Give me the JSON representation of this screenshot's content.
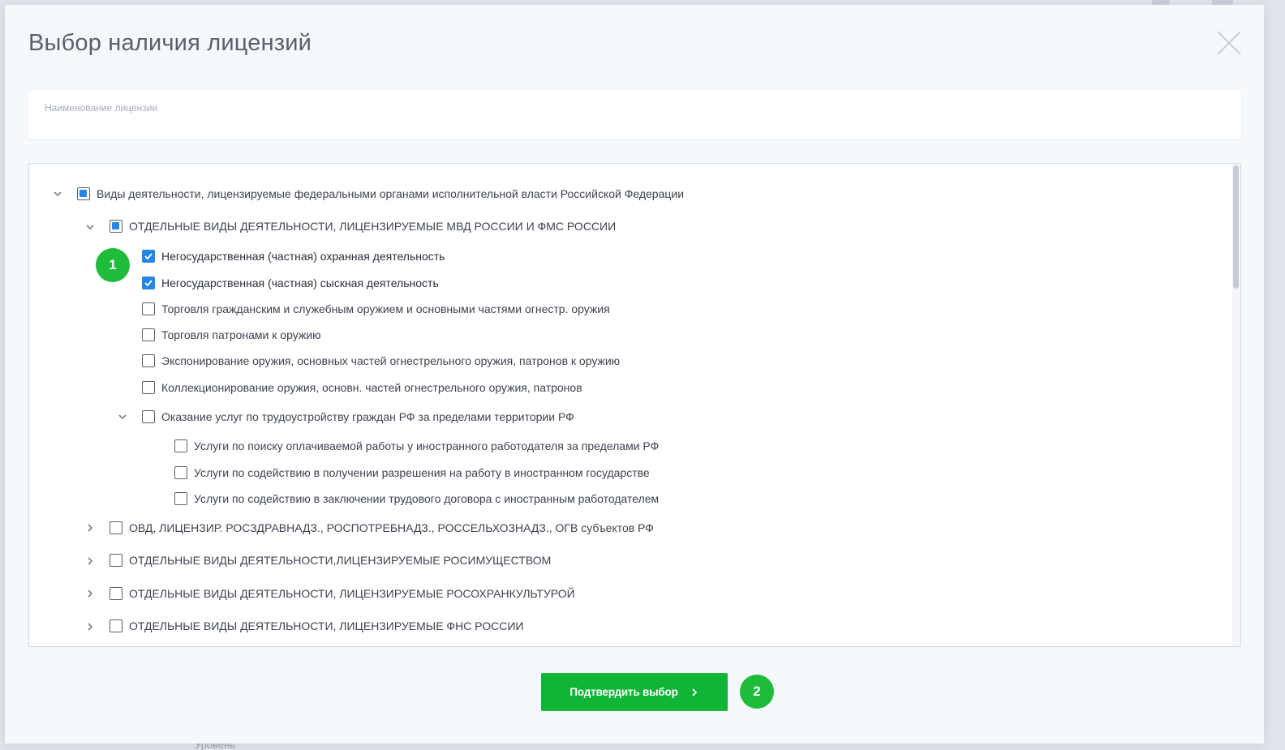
{
  "modal": {
    "title": "Выбор наличия лицензий",
    "search": {
      "label": "Наименование лицензии",
      "value": ""
    },
    "confirm_label": "Подтвердить выбор",
    "badges": {
      "first": "1",
      "second": "2"
    },
    "background_text": "Уровень"
  },
  "tree": {
    "root": {
      "label": "Виды деятельности, лицензируемые федеральными органами исполнительной власти Российской Федерации",
      "state": "partial",
      "expanded": true
    },
    "mvd": {
      "label": "ОТДЕЛЬНЫЕ ВИДЫ ДЕЯТЕЛЬНОСТИ, ЛИЦЕНЗИРУЕМЫЕ МВД РОССИИ И ФМС РОССИИ",
      "state": "partial",
      "expanded": true,
      "items": [
        {
          "label": "Негосударственная (частная) охранная деятельность",
          "checked": true
        },
        {
          "label": "Негосударственная (частная) сыскная деятельность",
          "checked": true
        },
        {
          "label": "Торговля гражданским и служебным оружием и основными частями огнестр. оружия",
          "checked": false
        },
        {
          "label": "Торговля патронами к оружию",
          "checked": false
        },
        {
          "label": "Экспонирование оружия, основных частей огнестрельного оружия, патронов к оружию",
          "checked": false
        },
        {
          "label": "Коллекционирование оружия, основн. частей огнестрельного оружия, патронов",
          "checked": false
        }
      ],
      "employment": {
        "label": "Оказание услуг по трудоустройству граждан РФ за пределами территории РФ",
        "checked": false,
        "expanded": true,
        "items": [
          {
            "label": "Услуги по поиску оплачиваемой работы у иностранного работодателя за пределами РФ",
            "checked": false
          },
          {
            "label": "Услуги по содействию в получении разрешения на работу в иностранном государстве",
            "checked": false
          },
          {
            "label": "Услуги по содействию в заключении трудового договора с иностранным работодателем",
            "checked": false
          }
        ]
      }
    },
    "groups": [
      {
        "label": "ОВД, ЛИЦЕНЗИР. РОСЗДРАВНАДЗ., РОСПОТРЕБНАДЗ., РОССЕЛЬХОЗНАДЗ., ОГВ субъектов РФ",
        "checked": false,
        "expanded": false
      },
      {
        "label": "ОТДЕЛЬНЫЕ ВИДЫ ДЕЯТЕЛЬНОСТИ,ЛИЦЕНЗИРУЕМЫЕ РОСИМУЩЕСТВОМ",
        "checked": false,
        "expanded": false
      },
      {
        "label": "ОТДЕЛЬНЫЕ ВИДЫ ДЕЯТЕЛЬНОСТИ, ЛИЦЕНЗИРУЕМЫЕ РОСОХРАНКУЛЬТУРОЙ",
        "checked": false,
        "expanded": false
      },
      {
        "label": "ОТДЕЛЬНЫЕ ВИДЫ ДЕЯТЕЛЬНОСТИ, ЛИЦЕНЗИРУЕМЫЕ ФНС РОССИИ",
        "checked": false,
        "expanded": false
      }
    ]
  },
  "colors": {
    "accent_blue": "#2486e6",
    "confirm_green": "#10b437",
    "badge_green": "#1fbb3b"
  },
  "icons": {
    "close": "close-icon",
    "expand": "chevron-down-icon",
    "collapsed": "chevron-right-icon",
    "check": "check-icon",
    "confirm_arrow": "chevron-right-icon"
  }
}
